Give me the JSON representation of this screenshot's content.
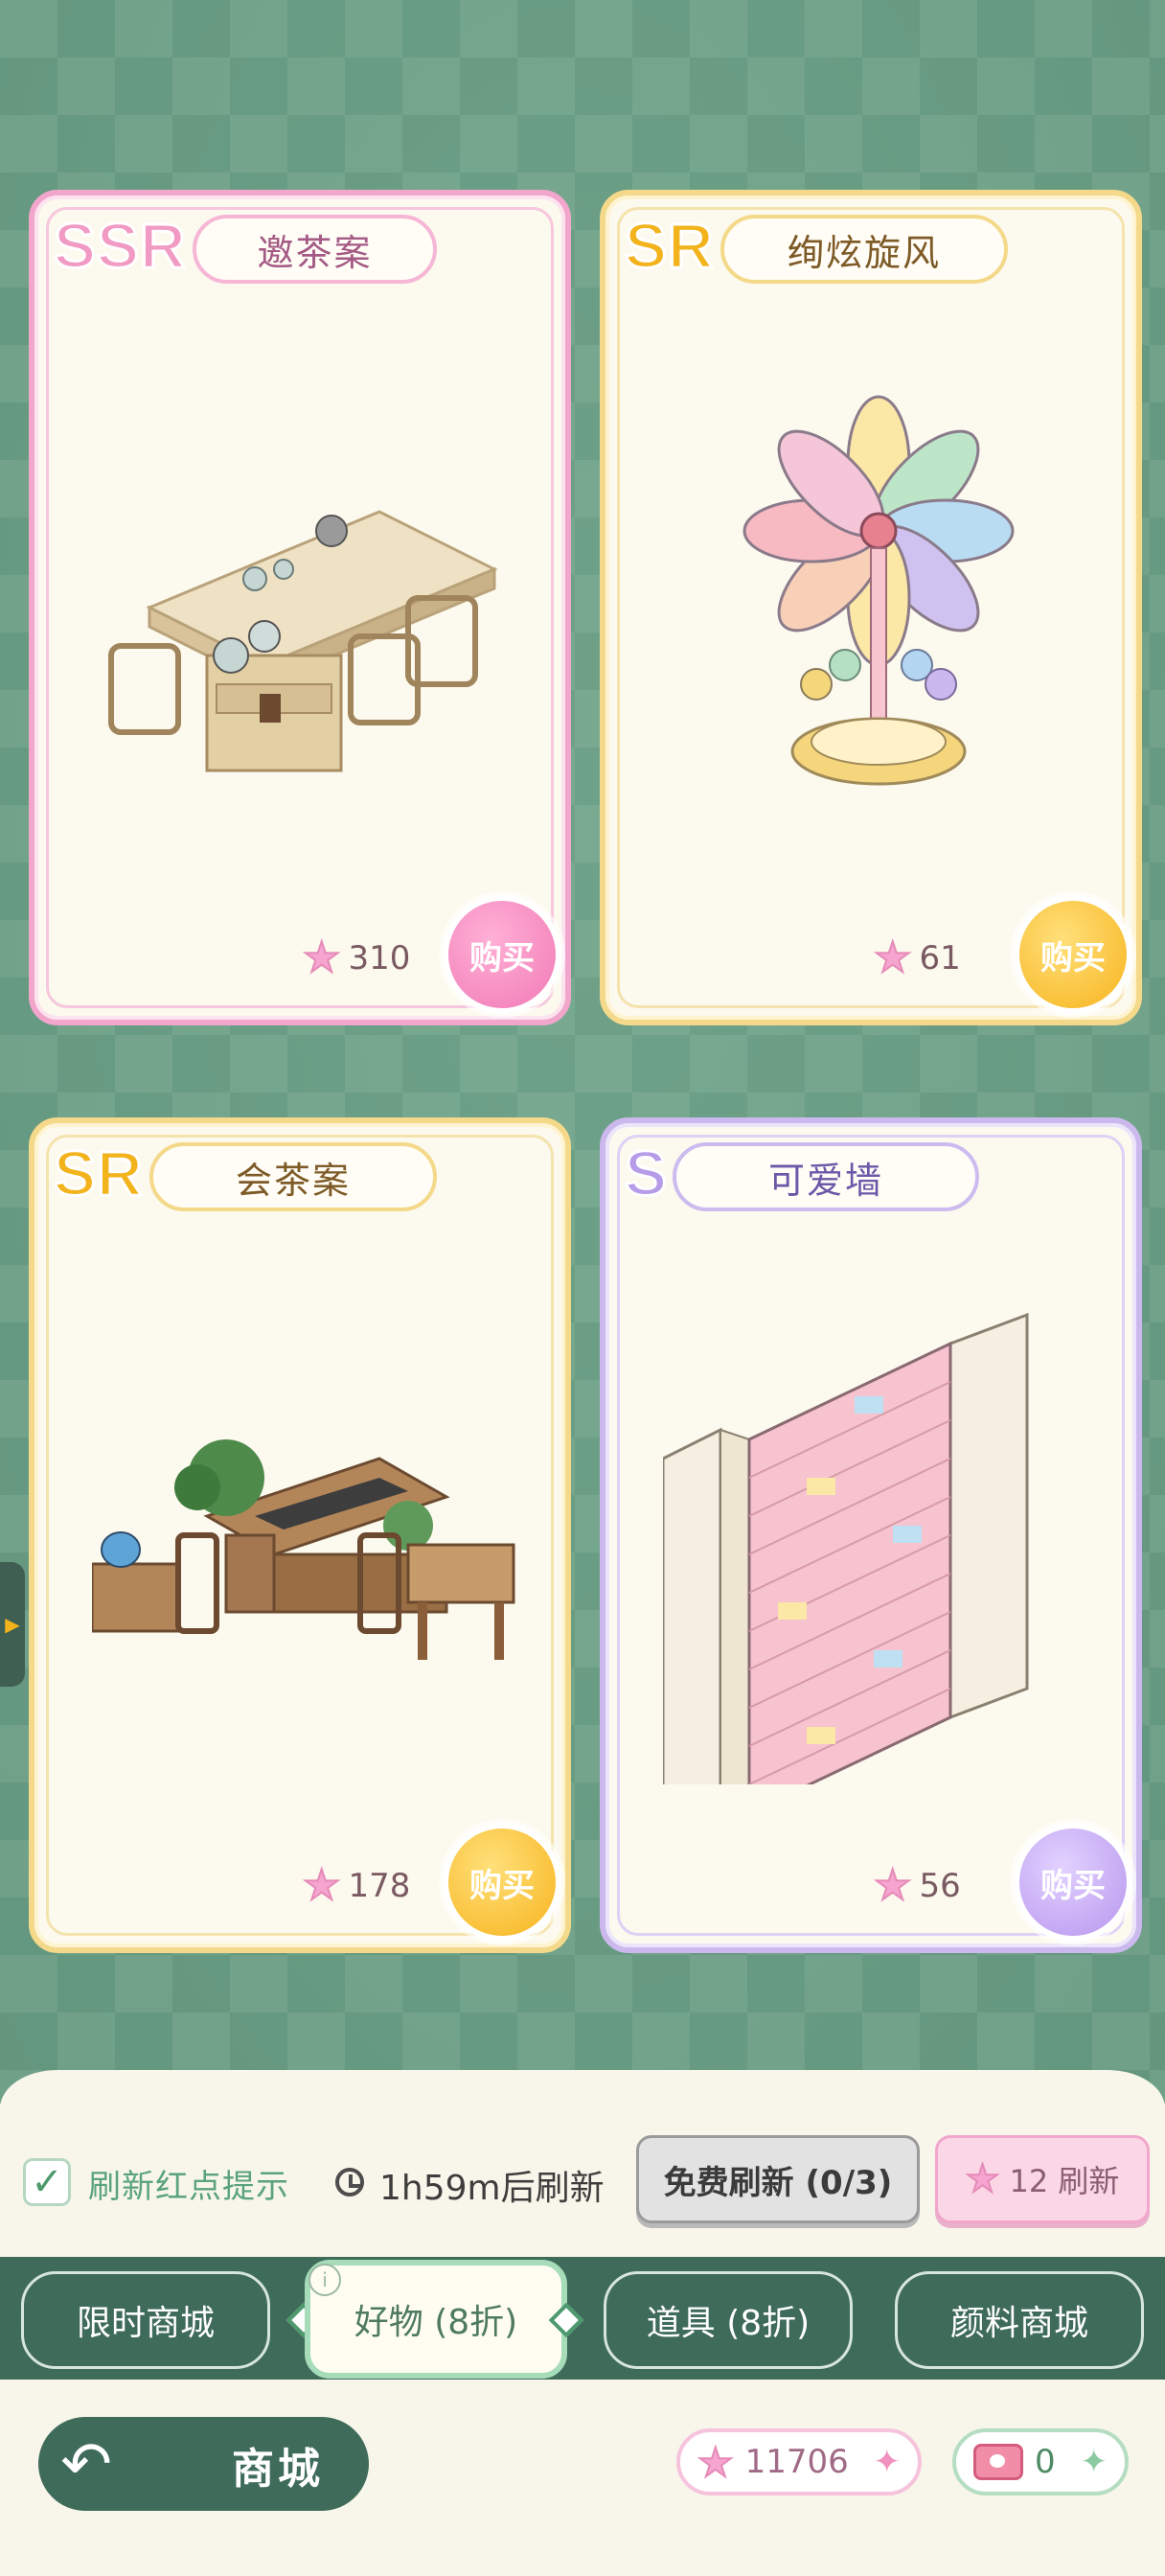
{
  "shop": {
    "title": "商城",
    "items": [
      {
        "rank": "SSR",
        "name": "邀茶案",
        "price": "310",
        "buy_label": "购买"
      },
      {
        "rank": "SR",
        "name": "绚炫旋风",
        "price": "61",
        "buy_label": "购买"
      },
      {
        "rank": "SR",
        "name": "会茶案",
        "price": "178",
        "buy_label": "购买"
      },
      {
        "rank": "S",
        "name": "可爱墙",
        "price": "56",
        "buy_label": "购买"
      }
    ]
  },
  "refresh": {
    "checkbox_label": "刷新红点提示",
    "timer_text": "1h59m后刷新",
    "free_button": "免费刷新 (0/3)",
    "paid_button": "12 刷新"
  },
  "tabs": [
    {
      "label": "限时商城",
      "active": false
    },
    {
      "label": "好物 (8折)",
      "active": true
    },
    {
      "label": "道具 (8折)",
      "active": false
    },
    {
      "label": "颜料商城",
      "active": false
    }
  ],
  "currency": {
    "gems": "11706",
    "tickets": "0"
  },
  "colors": {
    "ssr": "#f19ac4",
    "sr": "#f2b31c",
    "s": "#b59be8",
    "nav_green": "#3f6b5a"
  }
}
